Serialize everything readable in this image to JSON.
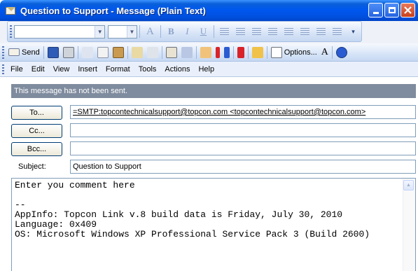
{
  "window": {
    "title": "Question to Support - Message (Plain Text)"
  },
  "format_toolbar": {
    "font_value": "",
    "size_value": "",
    "bold": "B",
    "italic": "I",
    "underline": "U",
    "font_color": "A"
  },
  "standard_toolbar": {
    "send_label": "Send",
    "options_label": "Options...",
    "font_size_label": "A"
  },
  "menu": {
    "items": [
      "File",
      "Edit",
      "View",
      "Insert",
      "Format",
      "Tools",
      "Actions",
      "Help"
    ]
  },
  "info_bar": {
    "text": "This message has not been sent."
  },
  "fields": {
    "to_button": "To...",
    "to_value": "=SMTP:topcontechnicalsupport@topcon.com <topcontechnicalsupport@topcon.com>",
    "cc_button": "Cc...",
    "cc_value": "",
    "bcc_button": "Bcc...",
    "bcc_value": "",
    "subject_label": "Subject:",
    "subject_value": "Question to Support"
  },
  "body": {
    "text": "Enter you comment here\n\n--\nAppInfo: Topcon Link v.8 build data is Friday, July 30, 2010\nLanguage: 0x409\nOS: Microsoft Windows XP Professional Service Pack 3 (Build 2600)"
  },
  "colors": {
    "titlebar_blue": "#0058ee",
    "info_bar_gray": "#7f8b9e",
    "close_red": "#c8401b"
  }
}
